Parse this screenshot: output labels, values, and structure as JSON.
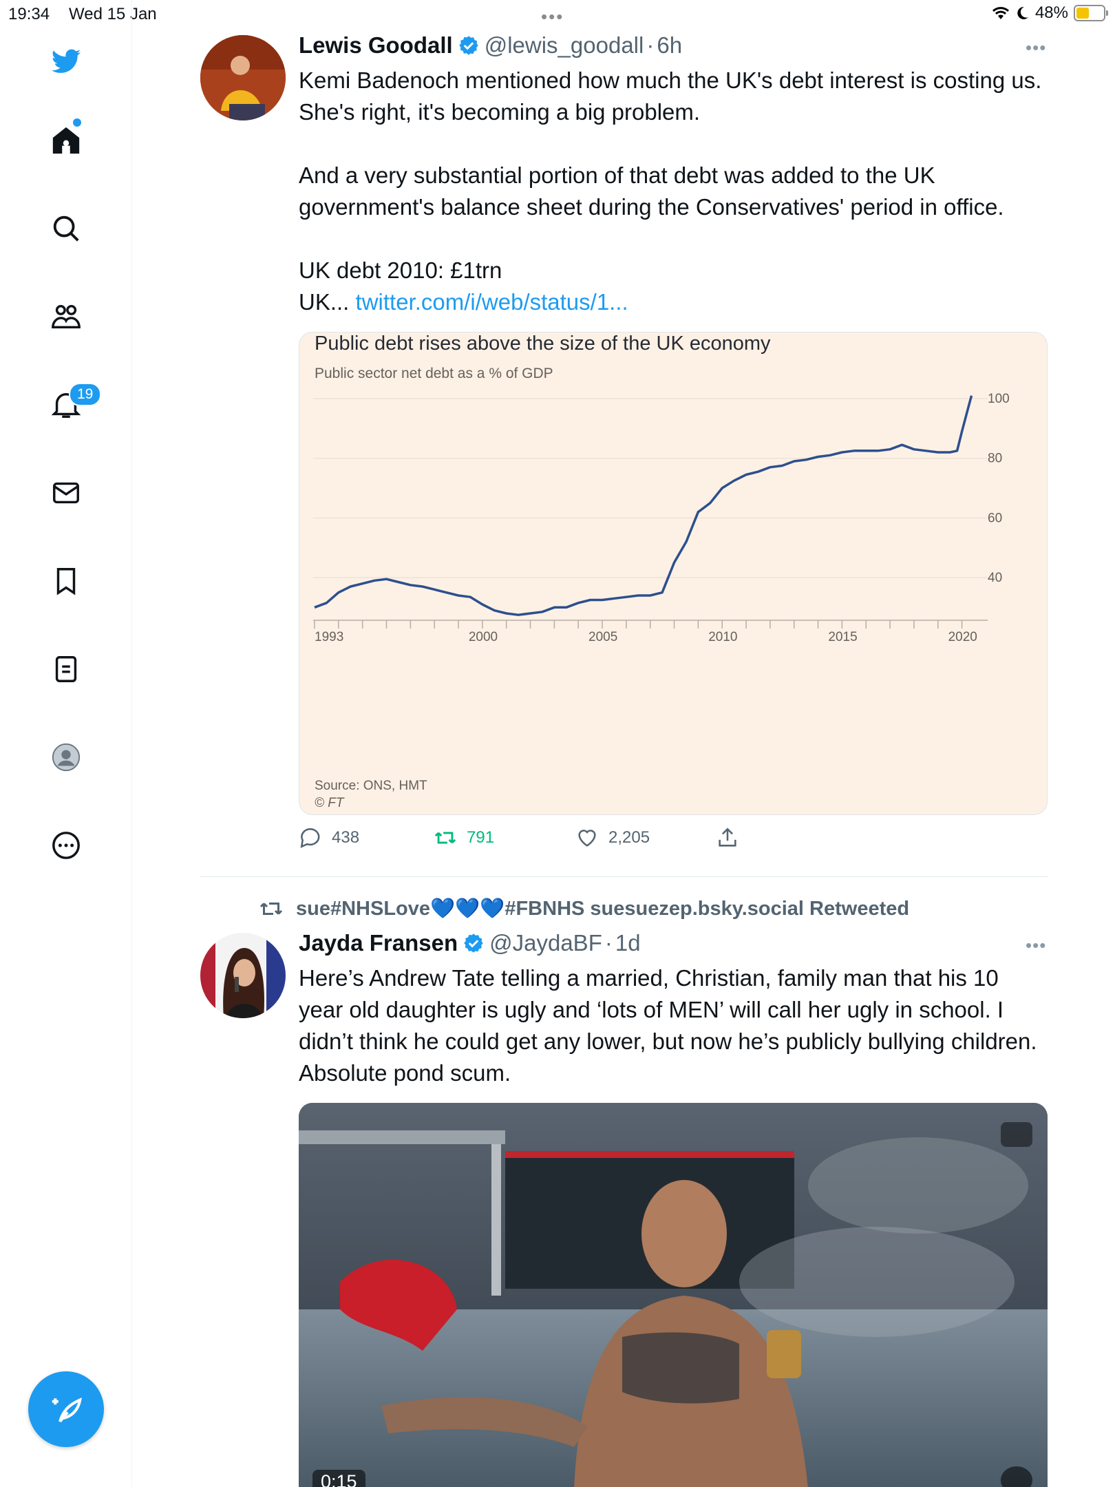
{
  "status_bar": {
    "time": "19:34",
    "date": "Wed 15 Jan",
    "battery": "48%",
    "battery_level": 0.48
  },
  "sidebar": {
    "notification_count": "19"
  },
  "tweet1": {
    "author_name": "Lewis Goodall",
    "handle": "@lewis_goodall",
    "separator": "·",
    "age": "6h",
    "text_p1": "Kemi Badenoch mentioned how much the UK's debt interest is costing us. She's right, it's becoming a big problem.",
    "text_p2": "And a very substantial portion of that debt was added to the UK government's balance sheet during the Conservatives' period in office.",
    "text_p3": "UK debt 2010: £1trn",
    "text_p4_prefix": "UK... ",
    "link_text": "twitter.com/i/web/status/1...",
    "replies": "438",
    "retweets": "791",
    "likes": "2,205"
  },
  "chart_data": {
    "type": "line",
    "title": "Public debt rises above the size of the UK economy",
    "subtitle": "Public sector net debt as a % of GDP",
    "source": "Source: ONS, HMT",
    "credit": "© FT",
    "x_ticks": [
      "1993",
      "2000",
      "2005",
      "2010",
      "2015",
      "2020"
    ],
    "y_ticks": [
      "40",
      "60",
      "80",
      "100"
    ],
    "xlim": [
      1993,
      2020.5
    ],
    "ylim": [
      25,
      101
    ],
    "series": [
      {
        "x": [
          1993,
          1993.5,
          1994,
          1994.5,
          1995,
          1995.5,
          1996,
          1996.5,
          1997,
          1997.5,
          1998,
          1998.5,
          1999,
          1999.5,
          2000,
          2000.5,
          2001,
          2001.5,
          2002,
          2002.5,
          2003,
          2003.5,
          2004,
          2004.5,
          2005,
          2005.5,
          2006,
          2006.5,
          2007,
          2007.5,
          2008,
          2008.5,
          2009,
          2009.5,
          2010,
          2010.5,
          2011,
          2011.5,
          2012,
          2012.5,
          2013,
          2013.5,
          2014,
          2014.5,
          2015,
          2015.5,
          2016,
          2016.5,
          2017,
          2017.5,
          2018,
          2018.5,
          2019,
          2019.5,
          2019.8,
          2020,
          2020.2,
          2020.4
        ],
        "y": [
          30,
          31.5,
          35,
          37,
          38,
          39,
          39.5,
          38.5,
          37.5,
          37,
          36,
          35,
          34,
          33.5,
          31,
          29,
          28,
          27.5,
          28,
          28.5,
          30,
          30,
          31.5,
          32.5,
          32.5,
          33,
          33.5,
          34,
          34,
          35,
          45,
          52,
          62,
          65,
          70,
          72.5,
          74.5,
          75.5,
          77,
          77.5,
          79,
          79.5,
          80.5,
          81,
          82,
          82.5,
          82.5,
          82.5,
          83,
          84.5,
          83,
          82.5,
          82,
          82,
          82.5,
          89,
          95,
          101
        ]
      }
    ]
  },
  "tweet2": {
    "retweeted_by": "sue#NHSLove💙💙💙#FBNHS suesuezep.bsky.social Retweeted",
    "author_name": "Jayda Fransen",
    "handle": "@JaydaBF",
    "separator": "·",
    "age": "1d",
    "text": "Here’s Andrew Tate telling a married, Christian, family man that his 10 year old daughter is ugly and ‘lots of MEN’ will call her ugly in school. I didn’t think he could get any lower, but now he’s publicly bullying children. Absolute pond scum.",
    "video_time": "0:15"
  },
  "colors": {
    "accent": "#1d9bf0",
    "chart_bg": "#fdf1e5",
    "chart_line": "#2d4f8e",
    "retweet_green": "#00ba7c"
  }
}
